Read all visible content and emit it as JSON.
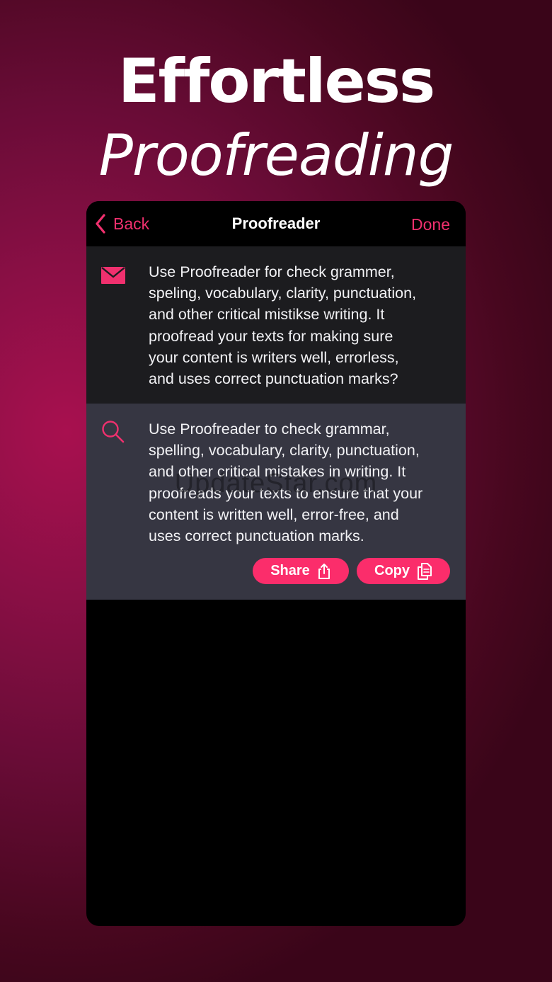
{
  "hero": {
    "line1": "Effortless",
    "line2": "Proofreading"
  },
  "navbar": {
    "back_label": "Back",
    "title": "Proofreader",
    "done_label": "Done"
  },
  "input_section": {
    "icon": "envelope-icon",
    "lines": [
      "Use Proofreader for check grammer,",
      "speling, vocabulary, clarity, punctuation,",
      "and other critical mistikse writing. It",
      "proofread your texts for making sure",
      "your content is writers well, errorless,",
      "and uses correct punctuation marks?"
    ]
  },
  "output_section": {
    "icon": "search-icon",
    "lines": [
      "Use Proofreader to check grammar,",
      "spelling, vocabulary, clarity, punctuation,",
      "and other critical mistakes in writing. It",
      "proofreads your texts to ensure that your",
      "content is written well, error-free, and",
      "uses correct punctuation marks."
    ],
    "share_label": "Share",
    "copy_label": "Copy"
  },
  "watermark": "UpdateStar.com",
  "colors": {
    "accent": "#f0306e",
    "button": "#fb2d6b",
    "input_bg": "#1c1c1f",
    "output_bg": "#363642",
    "background": "#8a0f45"
  }
}
